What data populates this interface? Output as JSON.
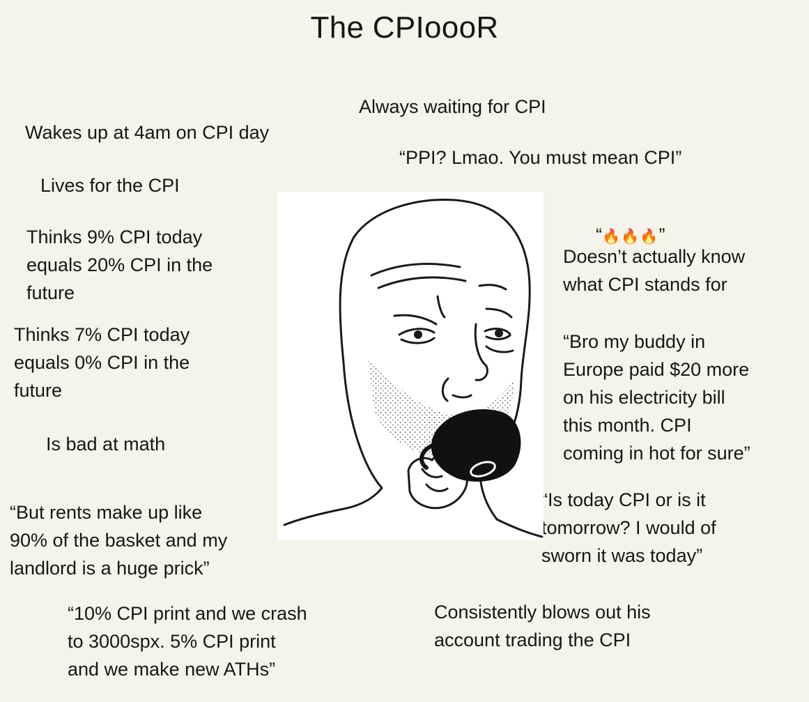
{
  "title": "The CPIoooR",
  "captions": {
    "always_waiting": "Always waiting for CPI",
    "wakes_up": "Wakes up at 4am on CPI day",
    "ppi": "“PPI? Lmao. You must mean CPI”",
    "lives_for": "Lives for the CPI",
    "fire_open": "“",
    "fire_emojis": "🔥🔥🔥",
    "fire_close": "”",
    "thinks_9": "Thinks 9% CPI today\nequals 20% CPI in the\nfuture",
    "doesnt_know": "Doesn’t actually know\nwhat CPI stands for",
    "thinks_7": "Thinks 7% CPI today\nequals 0% CPI in the\nfuture",
    "bro_buddy": "“Bro my buddy in\nEurope paid $20 more\non his electricity bill\nthis month. CPI\ncoming in hot for sure”",
    "bad_at_math": "Is bad at math",
    "is_today": "“Is today CPI or is it\ntomorrow? I would of\nsworn it was today”",
    "rents": "“But rents make up like\n90% of the basket and my\nlandlord is a huge prick”",
    "ten_percent": "“10% CPI print and we crash\nto 3000spx. 5% CPI print\nand we make new ATHs”",
    "blows_out": "Consistently blows out his\naccount trading the CPI"
  },
  "illustration": {
    "name": "wojak-coffee-drawing",
    "background": "#ffffff",
    "line_color": "#1a1a1a",
    "mug_color": "#111111"
  }
}
